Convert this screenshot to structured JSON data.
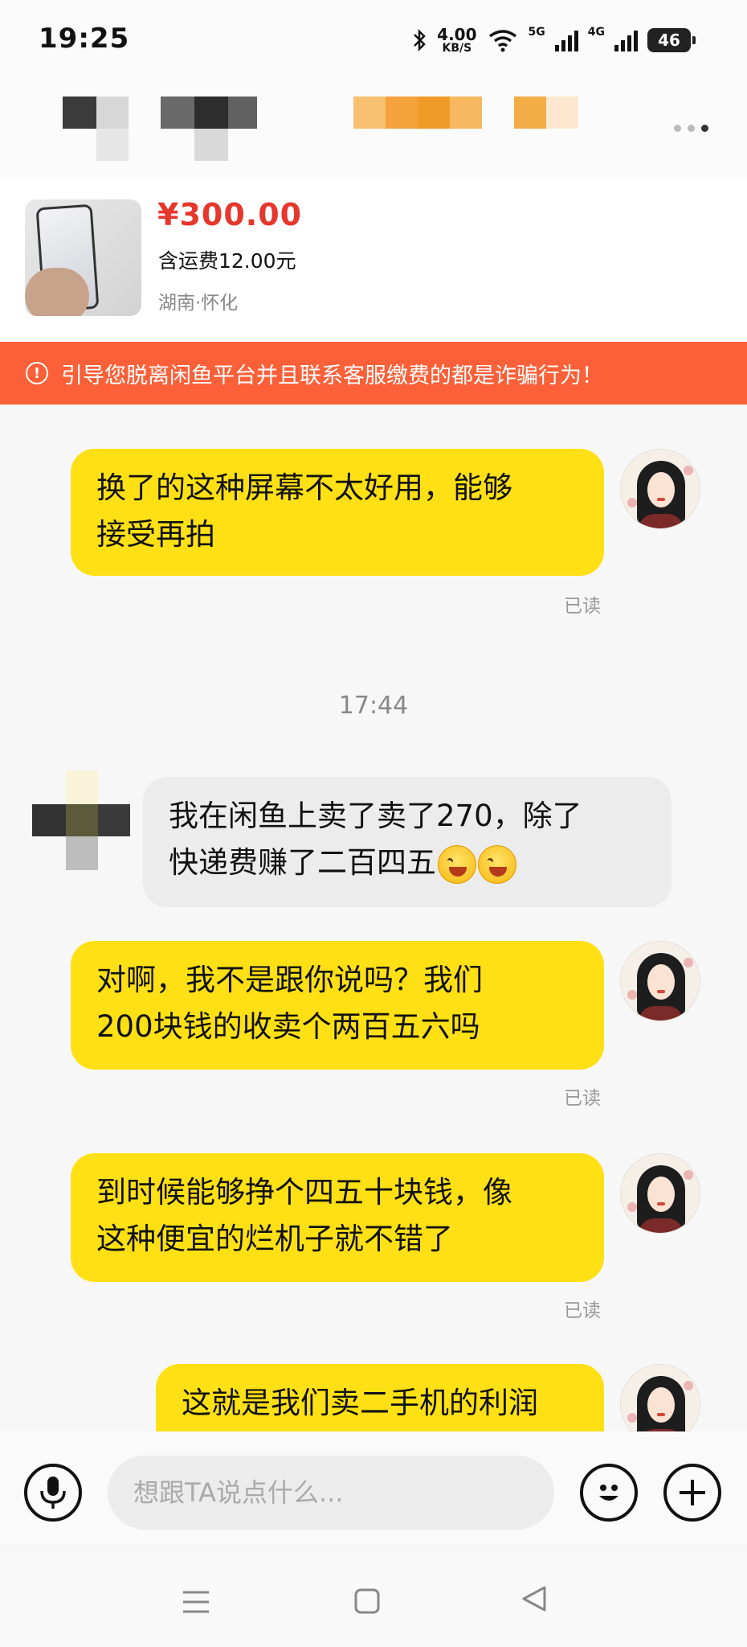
{
  "status_bar": {
    "time": "19:25",
    "speed_value": "4.00",
    "speed_unit": "KB/S",
    "net1": "5G",
    "net2": "4G",
    "battery": "46"
  },
  "product": {
    "price": "¥300.00",
    "shipping": "含运费12.00元",
    "location": "湖南·怀化"
  },
  "warning": {
    "icon": "!",
    "text": "引导您脱离闲鱼平台并且联系客服缴费的都是诈骗行为！"
  },
  "chat": {
    "timestamp": "17:44",
    "read_label": "已读",
    "messages": [
      {
        "line1": "换了的这种屏幕不太好用，能够",
        "line2": "接受再拍"
      },
      {
        "line1": "我在闲鱼上卖了卖了270，除了",
        "line2": "快递费赚了二百四五"
      },
      {
        "line1": "对啊，我不是跟你说吗？我们",
        "line2": "200块钱的收卖个两百五六吗"
      },
      {
        "line1": "到时候能够挣个四五十块钱，像",
        "line2": "这种便宜的烂机子就不错了"
      },
      {
        "line1": "这就是我们卖二手机的利润"
      }
    ]
  },
  "input": {
    "placeholder": "想跟TA说点什么..."
  },
  "icons": {
    "voice": "microphone-icon",
    "emoji": "smiley-icon",
    "add": "plus-icon",
    "menu": "menu-icon",
    "home": "home-icon",
    "back": "back-icon"
  },
  "colors": {
    "accent_yellow": "#ffe014",
    "warning_orange": "#fb6038",
    "price_red": "#e6372d"
  }
}
